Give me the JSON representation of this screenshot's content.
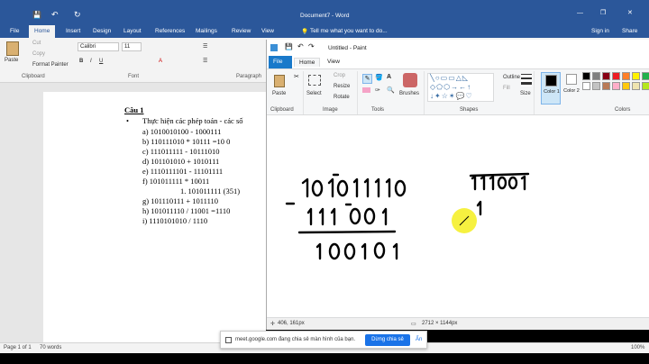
{
  "word": {
    "title": "Document7 - Word",
    "tabs": [
      "File",
      "Home",
      "Insert",
      "Design",
      "Layout",
      "References",
      "Mailings",
      "Review",
      "View"
    ],
    "tell_me": "Tell me what you want to do...",
    "sign_in": "Sign in",
    "share": "Share",
    "clipboard": {
      "paste": "Paste",
      "cut": "Cut",
      "copy": "Copy",
      "format_painter": "Format Painter",
      "label": "Clipboard"
    },
    "font": {
      "name": "Calibri",
      "size": "11",
      "label": "Font"
    },
    "paragraph_label": "Paragraph",
    "doc": {
      "heading": "Câu 1",
      "bullet": "Thực hiện các phép toán - các số",
      "items": [
        "a)     1010010100 - 1000111",
        "b)     110111010    * 10111 =10 0",
        "c)     111011111  - 10111010",
        "d)     101101010   + 1010111",
        "e)     1110111101 - 11101111",
        "f)      101011111    * 10011",
        "1.     101011111 (351)",
        "g)     101110111   + 1011110",
        "h)     101011110  /  11001 =1110",
        "i)      1110101010 / 1110"
      ]
    },
    "status": {
      "page": "Page 1 of 1",
      "words": "70 words",
      "zoom": "100%"
    }
  },
  "paint": {
    "title": "Untitled - Paint",
    "tabs": [
      "File",
      "Home",
      "View"
    ],
    "groups": {
      "clipboard": "Clipboard",
      "image": "Image",
      "tools": "Tools",
      "shapes": "Shapes",
      "colors": "Colors"
    },
    "buttons": {
      "paste": "Paste",
      "select": "Select",
      "crop": "Crop",
      "resize": "Resize",
      "rotate": "Rotate",
      "brushes": "Brushes",
      "outline": "Outline",
      "fill": "Fill",
      "size": "Size",
      "color1": "Color 1",
      "color2": "Color 2"
    },
    "palette": [
      "#000000",
      "#7f7f7f",
      "#880015",
      "#ed1c24",
      "#ff7f27",
      "#fff200",
      "#22b14c",
      "#00a2e8",
      "#3f48cc",
      "#a349a4",
      "#ffffff",
      "#c3c3c3",
      "#b97a57",
      "#ffaec9",
      "#ffc90e",
      "#efe4b0",
      "#b5e61d",
      "#99d9ea",
      "#7092be",
      "#c8bfe7"
    ],
    "status": {
      "cursor": "406, 161px",
      "canvas_size": "2712 × 1144px"
    }
  },
  "banner": {
    "text": "meet.google.com đang chia sẻ màn hình của bạn.",
    "stop_button": "Dừng chia sẻ",
    "hide": "Ẩn"
  }
}
